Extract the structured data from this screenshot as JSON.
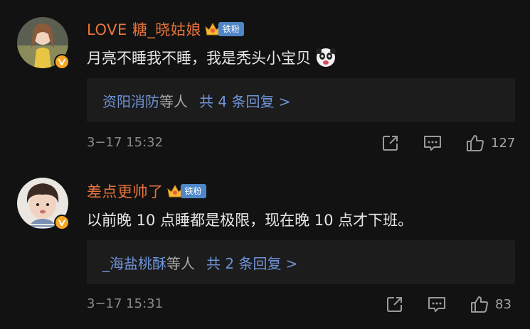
{
  "comments": [
    {
      "username": "LOVE 糖_晓姑娘",
      "fan_label": "铁粉",
      "content": "月亮不睡我不睡，我是秃头小宝贝",
      "reply_names": "资阳消防",
      "reply_etc": "等人",
      "reply_count": "共 4 条回复 >",
      "timestamp": "3−17 15:32",
      "like_count": "127"
    },
    {
      "username": "差点更帅了",
      "fan_label": "铁粉",
      "content": "以前晚 10 点睡都是极限，现在晚 10 点才下班。",
      "reply_names": "_海盐桃酥",
      "reply_etc": "等人",
      "reply_count": "共 2 条回复 >",
      "timestamp": "3−17 15:31",
      "like_count": "83"
    }
  ],
  "colors": {
    "background": "#121212",
    "username": "#e8743b",
    "reply_link": "#6f93d6",
    "fan_tag": "#4f86c8",
    "verified_badge": "#f5a623"
  }
}
